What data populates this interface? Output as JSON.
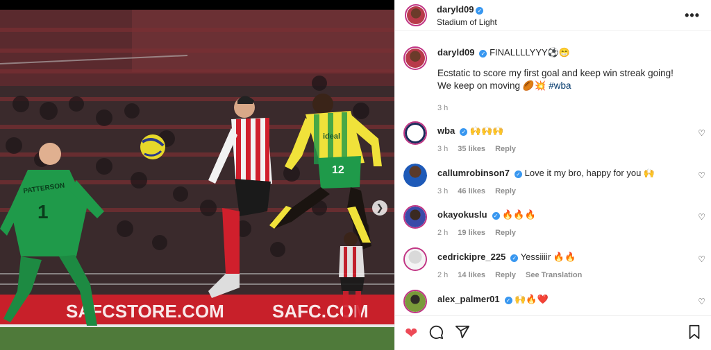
{
  "post": {
    "username": "daryld09",
    "location": "Stadium of Light",
    "more_label": "•••"
  },
  "caption": {
    "username": "daryld09",
    "title": "FINALLLLYYY⚽😁",
    "text": "Ecstatic to score my first goal and keep win streak going! We keep on moving 🏉💥",
    "hashtag": "#wba",
    "time": "3 h"
  },
  "comments": [
    {
      "username": "wba",
      "text": "🙌🙌🙌",
      "time": "3 h",
      "likes": "35 likes",
      "reply": "Reply",
      "extra": ""
    },
    {
      "username": "callumrobinson7",
      "text": "Love it my bro, happy for you 🙌",
      "time": "3 h",
      "likes": "46 likes",
      "reply": "Reply",
      "extra": ""
    },
    {
      "username": "okayokuslu",
      "text": "🔥🔥🔥",
      "time": "2 h",
      "likes": "19 likes",
      "reply": "Reply",
      "extra": ""
    },
    {
      "username": "cedrickipre_225",
      "text": "Yessiiiir 🔥🔥",
      "time": "2 h",
      "likes": "14 likes",
      "reply": "Reply",
      "extra": "See Translation"
    },
    {
      "username": "alex_palmer01",
      "text": "🙌🔥❤️",
      "time": "",
      "likes": "",
      "reply": "",
      "extra": ""
    }
  ],
  "photo": {
    "banner_text_left": "SAFCSTORE.COM",
    "banner_text_right": "SAFC.COM",
    "keeper_name": "PATTERSON",
    "keeper_number": "1",
    "striker_number": "12",
    "shirt_sponsor": "ideal"
  },
  "icons": {
    "like": "heart-icon",
    "comment": "comment-icon",
    "share": "share-icon",
    "save": "bookmark-icon",
    "next": "chevron-right-icon",
    "verified": "verified-badge-icon"
  },
  "colors": {
    "like_red": "#ed4956",
    "verified_blue": "#3897f0",
    "hashtag_blue": "#00376b",
    "meta_grey": "#8e8e8e"
  }
}
